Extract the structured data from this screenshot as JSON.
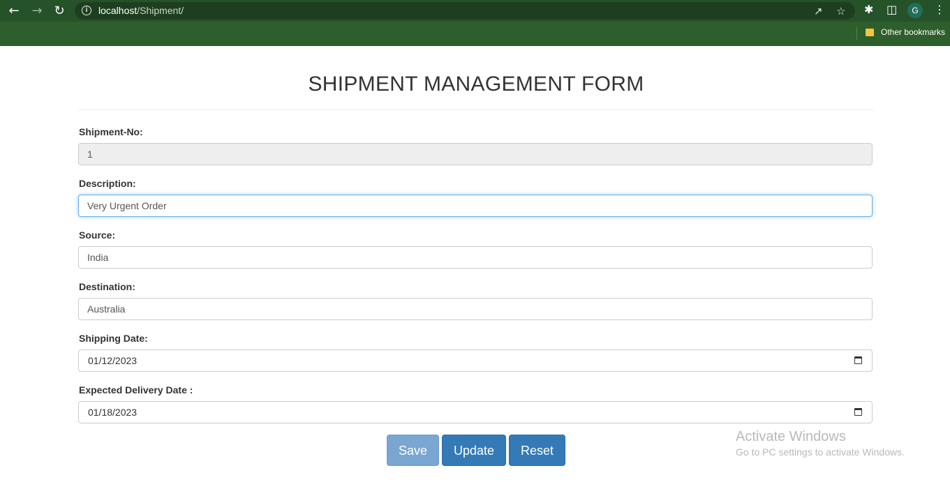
{
  "browser": {
    "url_host": "localhost",
    "url_path": "/Shipment/",
    "profile_initial": "G",
    "bookmarks_label": "Other bookmarks"
  },
  "form": {
    "title": "SHIPMENT MANAGEMENT FORM",
    "fields": {
      "shipment_no": {
        "label": "Shipment-No:",
        "value": "1"
      },
      "description": {
        "label": "Description:",
        "value": "Very Urgent Order"
      },
      "source": {
        "label": "Source:",
        "value": "India"
      },
      "destination": {
        "label": "Destination:",
        "value": "Australia"
      },
      "shipping_date": {
        "label": "Shipping Date:",
        "value": "01/12/2023"
      },
      "expected_delivery": {
        "label": "Expected Delivery Date :",
        "value": "01/18/2023"
      }
    },
    "buttons": {
      "save": "Save",
      "update": "Update",
      "reset": "Reset"
    }
  },
  "watermark": {
    "line1": "Activate Windows",
    "line2": "Go to PC settings to activate Windows."
  },
  "colors": {
    "chrome": "#2d5e2b",
    "primary": "#337ab7",
    "focus": "#66afe9"
  }
}
